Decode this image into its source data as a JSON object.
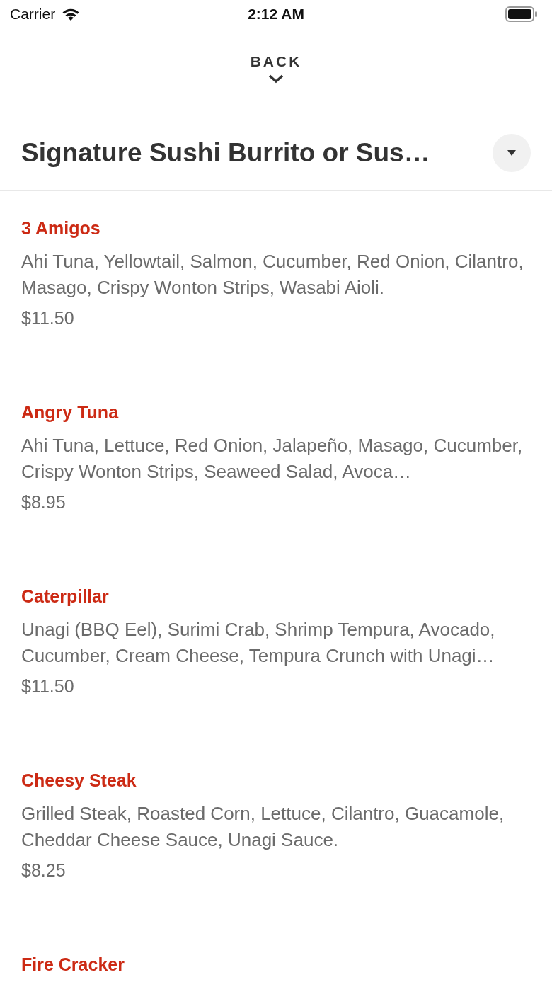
{
  "status_bar": {
    "carrier": "Carrier",
    "time": "2:12 AM"
  },
  "back": {
    "label": "BACK"
  },
  "category": {
    "title": "Signature Sushi Burrito or Sus…"
  },
  "items": [
    {
      "name": "3 Amigos",
      "description": "Ahi Tuna, Yellowtail, Salmon, Cucumber, Red Onion, Cilantro, Masago, Crispy Wonton Strips, Wasabi Aioli.",
      "price": "$11.50"
    },
    {
      "name": "Angry Tuna",
      "description": "Ahi Tuna, Lettuce, Red Onion, Jalapeño, Masago, Cucumber, Crispy Wonton Strips, Seaweed Salad, Avoca…",
      "price": "$8.95"
    },
    {
      "name": "Caterpillar",
      "description": "Unagi (BBQ Eel), Surimi Crab, Shrimp Tempura, Avocado, Cucumber, Cream Cheese, Tempura Crunch with Unagi…",
      "price": "$11.50"
    },
    {
      "name": "Cheesy Steak",
      "description": "Grilled Steak, Roasted Corn, Lettuce, Cilantro, Guacamole, Cheddar Cheese Sauce, Unagi Sauce.",
      "price": "$8.25"
    },
    {
      "name": "Fire Cracker"
    }
  ]
}
